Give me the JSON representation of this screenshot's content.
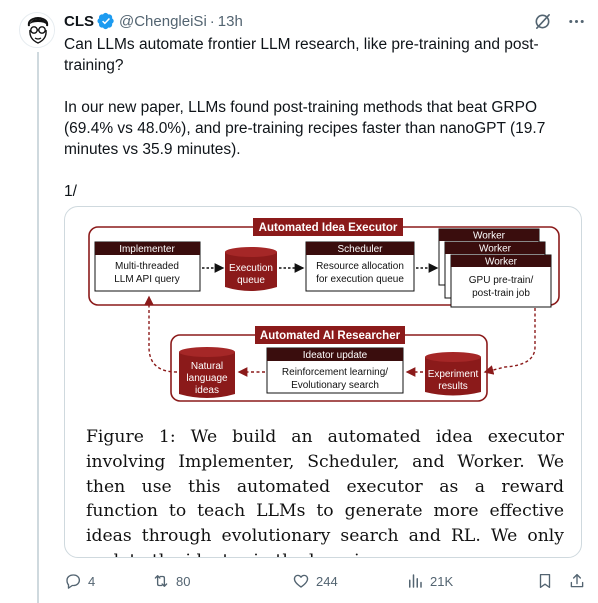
{
  "author": {
    "name": "CLS",
    "handle": "@ChengleiSi",
    "separator": "·",
    "time": "13h"
  },
  "tweet": {
    "paragraphs": [
      "Can LLMs automate frontier LLM research, like pre-training and post-training?",
      "In our new paper, LLMs found post-training methods that beat GRPO (69.4% vs 48.0%), and pre-training recipes faster than nanoGPT (19.7 minutes vs 35.9 minutes).",
      "1/"
    ]
  },
  "figure": {
    "executor_title": "Automated Idea Executor",
    "implementer": {
      "title": "Implementer",
      "body": [
        "Multi-threaded",
        "LLM API query"
      ]
    },
    "execution_queue": [
      "Execution",
      "queue"
    ],
    "scheduler": {
      "title": "Scheduler",
      "body": [
        "Resource allocation",
        "for execution queue"
      ]
    },
    "worker": {
      "title_1": "Worker",
      "title_2": "Worker",
      "title_3": "Worker",
      "body": [
        "GPU pre-train/",
        "post-train job"
      ]
    },
    "researcher_title": "Automated AI Researcher",
    "natural_ideas": [
      "Natural",
      "language",
      "ideas"
    ],
    "ideator": {
      "title": "Ideator update",
      "body": [
        "Reinforcement learning/",
        "Evolutionary search"
      ]
    },
    "experiment_results": [
      "Experiment",
      "results"
    ],
    "caption": "Figure 1: We build an automated idea executor involving Implementer, Scheduler, and Worker. We then use this automated executor as a reward function to teach LLMs to generate more effective ideas through evolutionary search and RL. We only update the ideator in the learning process."
  },
  "actions": {
    "replies": "4",
    "reposts": "80",
    "likes": "244",
    "views": "21K"
  },
  "colors": {
    "accent_red": "#8b1a1a",
    "verified_blue": "#1d9bf0",
    "muted": "#536471"
  }
}
